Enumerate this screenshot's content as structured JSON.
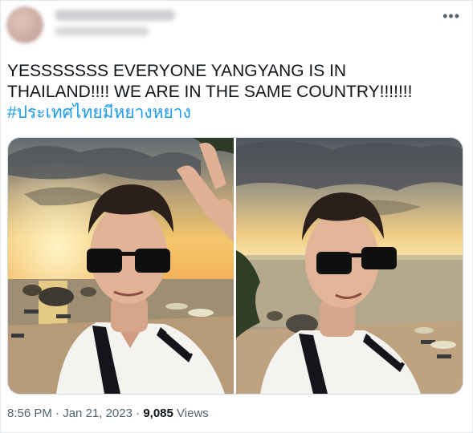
{
  "tweet": {
    "more_icon": "more-horizontal-icon",
    "text_line1": "YESSSSSSS EVERYONE YANGYANG IS IN",
    "text_line2": "THAILAND!!!! WE ARE IN THE SAME COUNTRY!!!!!!!",
    "hashtag": "#ประเทศไทยมีหยางหยาง",
    "time": "8:56 PM",
    "separator": "·",
    "date": "Jan 21, 2023",
    "views_count": "9,085",
    "views_label": "Views"
  },
  "colors": {
    "accent": "#1d9bf0",
    "text": "#0f1419",
    "secondary": "#536471"
  }
}
